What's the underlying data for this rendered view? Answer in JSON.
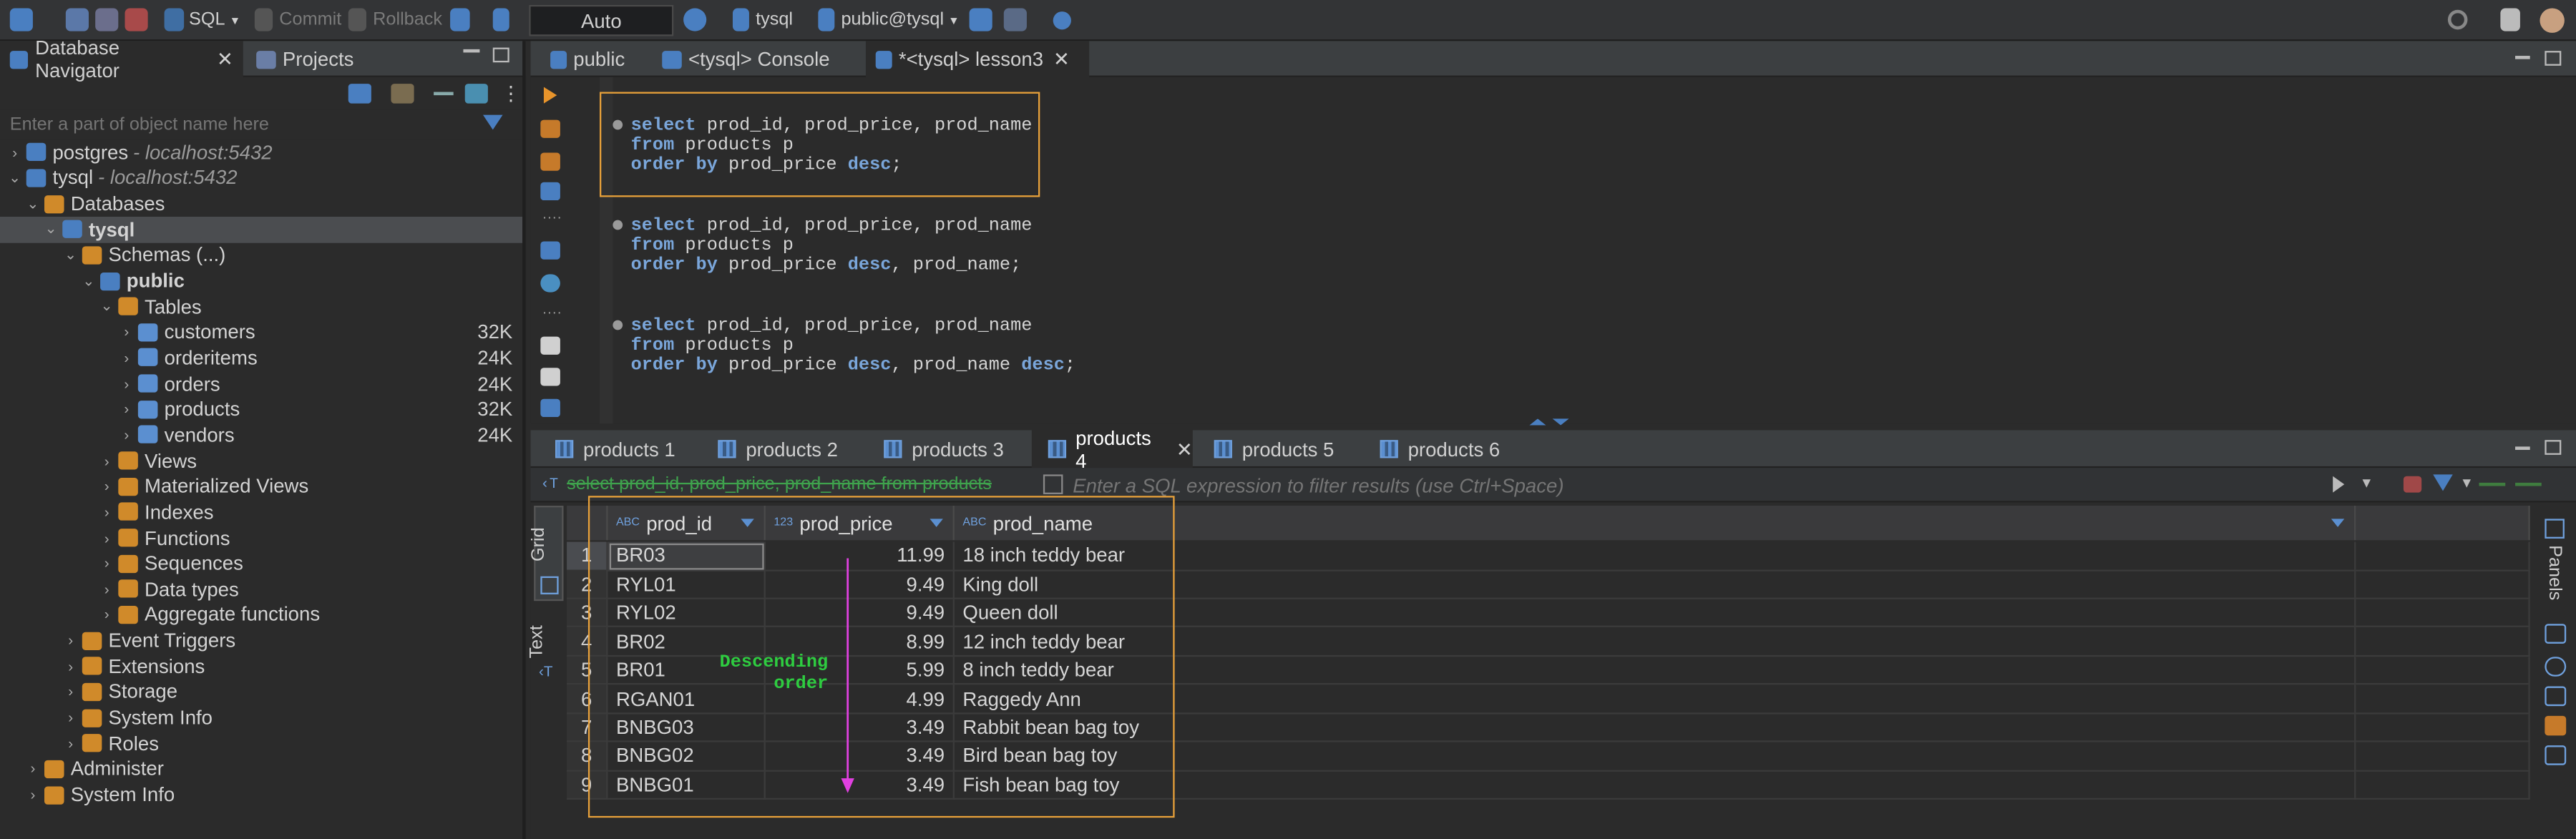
{
  "toolbar": {
    "sql_label": "SQL",
    "commit_label": "Commit",
    "rollback_label": "Rollback",
    "tx_mode": "Auto",
    "connection": "tysql",
    "schema": "public@tysql"
  },
  "left_panel": {
    "tabs": [
      "Database Navigator",
      "Projects"
    ],
    "filter_placeholder": "Enter a part of object name here",
    "tree": [
      {
        "label": "postgres",
        "host": " - localhost:5432"
      },
      {
        "label": "tysql",
        "host": " - localhost:5432"
      },
      {
        "label": "Databases"
      },
      {
        "label": "tysql"
      },
      {
        "label": "Schemas (...)"
      },
      {
        "label": "public"
      },
      {
        "label": "Tables"
      },
      {
        "label": "customers",
        "size": "32K"
      },
      {
        "label": "orderitems",
        "size": "24K"
      },
      {
        "label": "orders",
        "size": "24K"
      },
      {
        "label": "products",
        "size": "32K"
      },
      {
        "label": "vendors",
        "size": "24K"
      },
      {
        "label": "Views"
      },
      {
        "label": "Materialized Views"
      },
      {
        "label": "Indexes"
      },
      {
        "label": "Functions"
      },
      {
        "label": "Sequences"
      },
      {
        "label": "Data types"
      },
      {
        "label": "Aggregate functions"
      },
      {
        "label": "Event Triggers"
      },
      {
        "label": "Extensions"
      },
      {
        "label": "Storage"
      },
      {
        "label": "System Info"
      },
      {
        "label": "Roles"
      },
      {
        "label": "Administer"
      },
      {
        "label": "System Info"
      }
    ]
  },
  "editor": {
    "tabs": [
      "public",
      "<tysql> Console",
      "*<tysql> lesson3"
    ],
    "queries": [
      [
        "select",
        " prod_id, prod_price, prod_name",
        "from",
        " products p",
        "order by",
        " prod_price ",
        "desc",
        ";"
      ],
      [
        "select",
        " prod_id, prod_price, prod_name",
        "from",
        " products p",
        "order by",
        " prod_price ",
        "desc",
        ", prod_name;"
      ],
      [
        "select",
        " prod_id, prod_price, prod_name",
        "from",
        " products p",
        "order by",
        " prod_price ",
        "desc",
        ", prod_name ",
        "desc",
        ";"
      ]
    ]
  },
  "results": {
    "tabs": [
      "products 1",
      "products 2",
      "products 3",
      "products 4",
      "products 5",
      "products 6"
    ],
    "active_tab": "products 4",
    "query_text": "select prod_id, prod_price, prod_name from products",
    "filter_placeholder": "Enter a SQL expression to filter results (use Ctrl+Space)",
    "side_tabs": [
      "Grid",
      "Text"
    ],
    "right_label": "Panels",
    "columns": [
      {
        "type": "ABC",
        "name": "prod_id"
      },
      {
        "type": "123",
        "name": "prod_price"
      },
      {
        "type": "ABC",
        "name": "prod_name"
      }
    ],
    "rows": [
      [
        "1",
        "BR03",
        "11.99",
        "18 inch teddy bear"
      ],
      [
        "2",
        "RYL01",
        "9.49",
        "King doll"
      ],
      [
        "3",
        "RYL02",
        "9.49",
        "Queen doll"
      ],
      [
        "4",
        "BR02",
        "8.99",
        "12 inch teddy bear"
      ],
      [
        "5",
        "BR01",
        "5.99",
        "8 inch teddy bear"
      ],
      [
        "6",
        "RGAN01",
        "4.99",
        "Raggedy Ann"
      ],
      [
        "7",
        "BNBG03",
        "3.49",
        "Rabbit bean bag toy"
      ],
      [
        "8",
        "BNBG02",
        "3.49",
        "Bird bean bag toy"
      ],
      [
        "9",
        "BNBG01",
        "3.49",
        "Fish bean bag toy"
      ]
    ],
    "annotation": {
      "line1": "Descending",
      "line2": "order"
    }
  },
  "colors": {
    "highlight_box": "#e8a13a",
    "annotation_text": "#2ecc40",
    "arrow": "#e040e0",
    "keyword": "#7aa6da"
  }
}
